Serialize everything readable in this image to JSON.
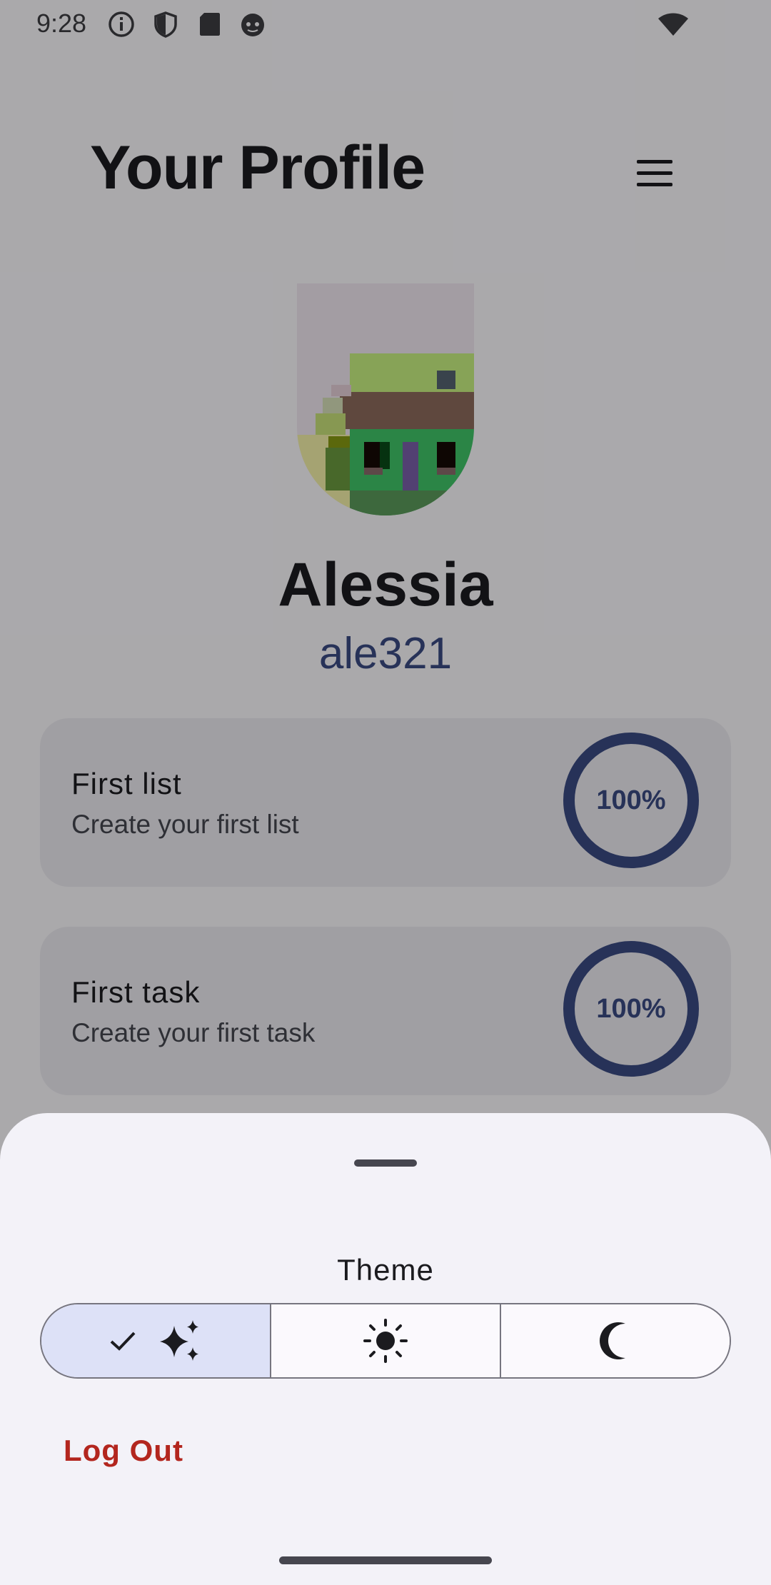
{
  "status_bar": {
    "time": "9:28",
    "icons": [
      "info-icon",
      "shield-icon",
      "sd-card-icon",
      "cat-face-icon"
    ],
    "right_icons": [
      "wifi-icon"
    ]
  },
  "header": {
    "title": "Your Profile",
    "menu_icon": "hamburger-menu-icon"
  },
  "profile": {
    "name": "Alessia",
    "username": "ale321",
    "avatar": "pixel-art-avatar"
  },
  "achievements": [
    {
      "title": "First list",
      "description": "Create your first list",
      "progress_label": "100%",
      "progress": 1.0
    },
    {
      "title": "First task",
      "description": "Create your first task",
      "progress_label": "100%",
      "progress": 1.0
    }
  ],
  "sheet": {
    "theme_label": "Theme",
    "theme_options": [
      {
        "icon": "auto-sparkles-icon",
        "selected": true,
        "selected_icon": "check-icon"
      },
      {
        "icon": "sun-icon",
        "selected": false
      },
      {
        "icon": "moon-icon",
        "selected": false
      }
    ],
    "logout_label": "Log Out"
  },
  "colors": {
    "primary": "#3a4a82",
    "error": "#b3261e",
    "selected_segment": "#dde1f7",
    "sheet_bg": "#f3f2f8"
  }
}
